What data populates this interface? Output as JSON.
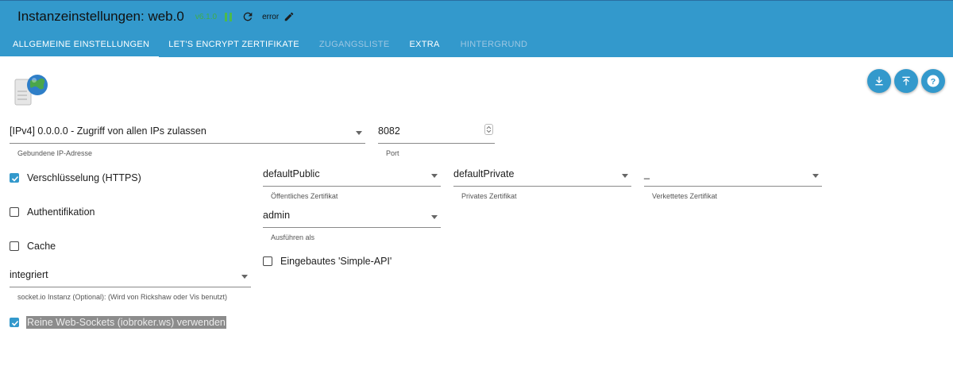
{
  "header": {
    "title": "Instanzeinstellungen: web.0",
    "version": "v6.1.0",
    "status": "error"
  },
  "tabs": [
    {
      "label": "Allgemeine Einstellungen"
    },
    {
      "label": "Let's Encrypt Zertifikate"
    },
    {
      "label": "Zugangsliste"
    },
    {
      "label": "Extra"
    },
    {
      "label": "Hintergrund"
    }
  ],
  "form": {
    "bind": {
      "value": "[IPv4] 0.0.0.0 - Zugriff von allen IPs zulassen",
      "helper": "Gebundene IP-Adresse"
    },
    "port": {
      "value": "8082",
      "helper": "Port"
    },
    "https": {
      "label": "Verschlüsselung (HTTPS)",
      "checked": true
    },
    "auth": {
      "label": "Authentifikation",
      "checked": false
    },
    "cache": {
      "label": "Cache",
      "checked": false
    },
    "socketio": {
      "value": "integriert",
      "helper": "socket.io Instanz (Optional): (Wird von Rickshaw oder Vis benutzt)"
    },
    "websockets": {
      "label": "Reine Web-Sockets (iobroker.ws) verwenden",
      "checked": true
    },
    "cert_public": {
      "value": "defaultPublic",
      "helper": "Öffentliches Zertifikat"
    },
    "cert_private": {
      "value": "defaultPrivate",
      "helper": "Privates Zertifikat"
    },
    "cert_chained": {
      "value": "_",
      "helper": "Verkettetes Zertifikat"
    },
    "run_as": {
      "value": "admin",
      "helper": "Ausführen als"
    },
    "simple_api": {
      "label": "Eingebautes 'Simple-API'",
      "checked": false
    }
  },
  "colors": {
    "accent": "#3399cc",
    "status_ok": "#4cba4c"
  },
  "icons": [
    "pause-icon",
    "refresh-icon",
    "edit-icon",
    "download-icon",
    "upload-icon",
    "help-icon",
    "web-logo-icon"
  ]
}
